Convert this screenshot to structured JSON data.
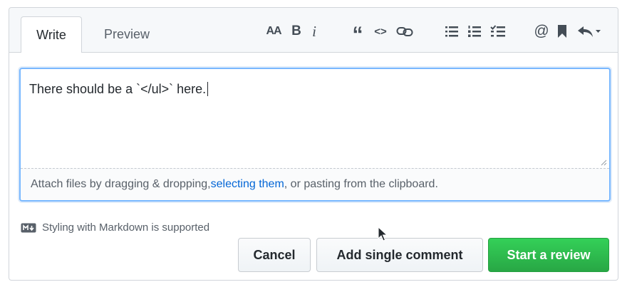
{
  "tabs": [
    {
      "label": "Write",
      "active": true
    },
    {
      "label": "Preview",
      "active": false
    }
  ],
  "toolbar": {
    "heading_icon_text": "AA",
    "bold_icon_text": "B",
    "italic_icon_text": "i",
    "quote_icon_text": "“",
    "code_icon_text": "<>",
    "mention_icon_text": "@"
  },
  "editor": {
    "value": "There should be a `</ul>` here.",
    "drop_prefix": "Attach files by dragging & dropping, ",
    "drop_link": "selecting them",
    "drop_suffix": ", or pasting from the clipboard."
  },
  "markdown_note": "Styling with Markdown is supported",
  "buttons": {
    "cancel": "Cancel",
    "single_comment": "Add single comment",
    "start_review": "Start a review"
  },
  "colors": {
    "accent": "#0366d6",
    "primary_green": "#28a745",
    "focus_border": "#79b8ff"
  }
}
